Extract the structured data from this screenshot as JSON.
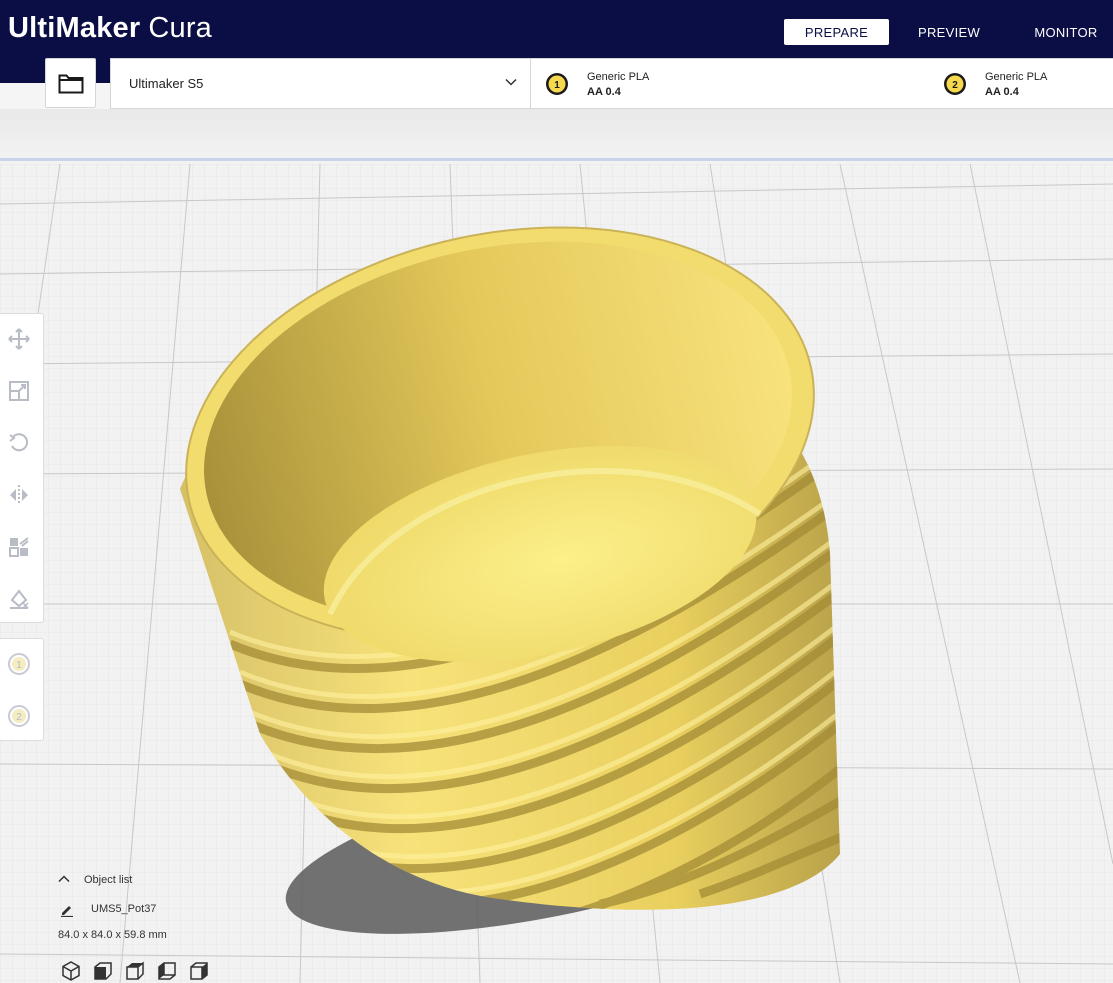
{
  "app": {
    "brand_bold": "UltiMaker",
    "brand_light": "Cura"
  },
  "nav": {
    "prepare": "PREPARE",
    "preview": "PREVIEW",
    "monitor": "MONITOR"
  },
  "machine": {
    "name": "Ultimaker S5"
  },
  "extruders": [
    {
      "number": "1",
      "material": "Generic PLA",
      "nozzle": "AA 0.4"
    },
    {
      "number": "2",
      "material": "Generic PLA",
      "nozzle": "AA 0.4"
    }
  ],
  "sidebar": {
    "tools": [
      "move-icon",
      "scale-icon",
      "rotate-icon",
      "mirror-icon",
      "per-model-settings-icon",
      "support-blocker-icon"
    ],
    "extruder_badges": [
      "1",
      "2"
    ]
  },
  "object_list": {
    "label": "Object list",
    "object_name": "UMS5_Pot37",
    "dimensions": "84.0 x 84.0 x 59.8 mm"
  },
  "view_buttons": [
    "3d-view-icon",
    "front-view-icon",
    "top-view-icon",
    "left-view-icon",
    "right-view-icon"
  ],
  "colors": {
    "header": "#0b0e45",
    "model": "#f7e27a",
    "badge": "#f5d84b"
  }
}
